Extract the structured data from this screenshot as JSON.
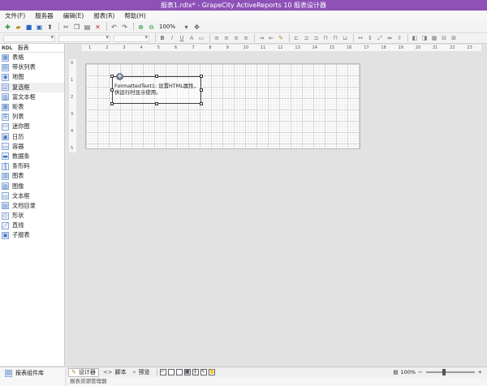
{
  "window": {
    "title": "报表1.rdlx* - GrapeCity ActiveReports 10 报表设计器"
  },
  "menu": [
    "文件(F)",
    "服务器",
    "编辑(E)",
    "报表(R)",
    "帮助(H)"
  ],
  "toolbar": {
    "zoom_value": "100%"
  },
  "toolbox": {
    "header_badge": "RDL",
    "header_label": "报表",
    "items": [
      "表格",
      "带状列表",
      "地图",
      "复选框",
      "富文本框",
      "矩表",
      "列表",
      "迷你图",
      "日历",
      "容器",
      "数据条",
      "条形码",
      "图表",
      "图像",
      "文本框",
      "文档目录",
      "形状",
      "直线",
      "子报表"
    ],
    "selected_index": 3,
    "footer_tab": "报表组件库"
  },
  "designer": {
    "ruler_top": [
      "1",
      "2",
      "3",
      "4",
      "5",
      "6",
      "7",
      "8",
      "9",
      "10",
      "11",
      "12",
      "13",
      "14",
      "15",
      "16",
      "17",
      "18",
      "19",
      "20",
      "21",
      "22",
      "23"
    ],
    "ruler_left": [
      "0",
      "1",
      "2",
      "3",
      "4",
      "5"
    ],
    "formatted_text": "FormattedText1: 设置HTML属性，供运行时显示使用。"
  },
  "bottom": {
    "design_tab": "设计器",
    "script_tab": "脚本",
    "preview_tab": "预览",
    "zoom_label": "100%"
  },
  "status": {
    "text": "报表资源管理器"
  }
}
